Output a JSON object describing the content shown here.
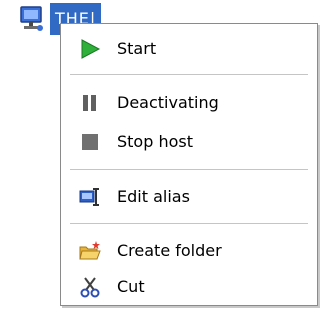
{
  "tree": {
    "label": "THE|",
    "icon": "computer-icon"
  },
  "menu": {
    "items": [
      {
        "label": "Start",
        "icon": "play-icon"
      },
      {
        "label": "Deactivating",
        "icon": "pause-icon"
      },
      {
        "label": "Stop host",
        "icon": "stop-icon"
      },
      {
        "label": "Edit alias",
        "icon": "edit-alias-icon"
      },
      {
        "label": "Create folder",
        "icon": "new-folder-icon"
      },
      {
        "label": "Cut",
        "icon": "scissors-icon"
      }
    ]
  },
  "colors": {
    "selection": "#316ac5",
    "play": "#2fb03a",
    "pause": "#606060",
    "stop": "#707070",
    "folder": "#f2c84b"
  }
}
